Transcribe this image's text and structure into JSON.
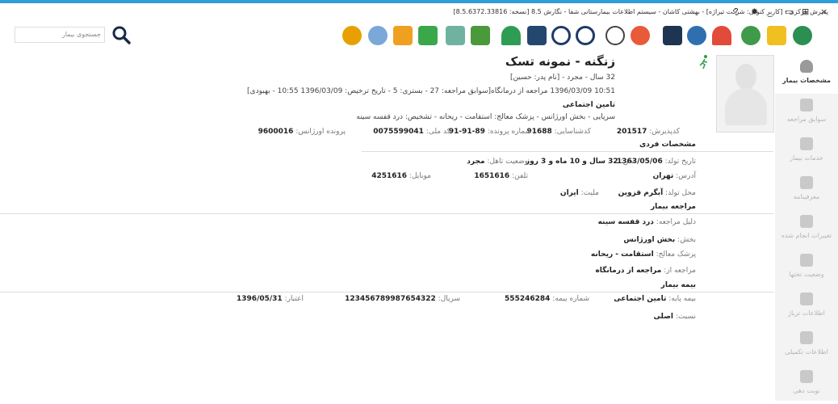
{
  "window": {
    "title": "پذیرش مرکزی - [کاربر کنونی: شرکت تیراژه] - بهشتی کاشان - سیستم اطلاعات بیمارستانی شفا - نگارش 8.5 [نسخه: 8.5.6372.33816]",
    "controls": [
      "?",
      "✹",
      "_",
      "▭",
      "⊞",
      "×"
    ]
  },
  "search": {
    "placeholder": "جستجوی بیمار"
  },
  "sidebar": {
    "items": [
      {
        "label": "مشخصات بیمار"
      },
      {
        "label": "سوابق مراجعه"
      },
      {
        "label": "خدمات بیمار"
      },
      {
        "label": "معرفینامه"
      },
      {
        "label": "تغییرات انجام شده"
      },
      {
        "label": "وضعیت تختها"
      },
      {
        "label": "اطلاعات تریاژ"
      },
      {
        "label": "اطلاعات تکمیلی"
      },
      {
        "label": "نوبت دهی"
      }
    ]
  },
  "patient": {
    "name": "زنگنه - نمونه تسک",
    "summary": "32 سال - مجرد - [نام پدر: حسین]",
    "visit_line": "10:51 1396/03/09 مراجعه از درمانگاه[سوابق مراجعه: 27 - بستری: 5 - تاریخ ترخیص: 1396/03/09 10:55 - بهبودی]",
    "insurance": "تامین اجتماعی",
    "ward_line": "سرپایی - بخش اورژانس - پزشک معالج: استقامت - ریحانه - تشخیص: درد قفسه سینه",
    "ids": {
      "reception_label": "کدپذیرش:",
      "reception": "201517",
      "codeshenasaei_label": "کدشناسایی:",
      "codeshenasaei": "91688",
      "file_label": "شماره پرونده:",
      "file": "89-91-91",
      "national_label": "کد ملی:",
      "national": "0075599041",
      "er_file_label": "پرونده اورژانس:",
      "er_file": "9600016"
    }
  },
  "personal": {
    "title": "مشخصات فردی",
    "birth_label": "تاریخ تولد:",
    "birth": "1363/05/06",
    "age_label": "سن:",
    "age": "32 سال و 10 ماه و 3 روز",
    "marital_label": "وضعیت تاهل:",
    "marital": "مجرد",
    "address_label": "آدرس:",
    "address": "تهران",
    "phone_label": "تلفن:",
    "phone": "1651616",
    "mobile_label": "موبایل:",
    "mobile": "4251616",
    "birthplace_label": "محل تولد:",
    "birthplace": "آبگرم قزوین",
    "nationality_label": "ملیت:",
    "nationality": "ایران"
  },
  "visit": {
    "title": "مراجعه بیمار",
    "reason_label": "دلیل مراجعه:",
    "reason": "درد قفسه سینه",
    "ward_label": "بخش:",
    "ward": "بخش اورژانس",
    "doctor_label": "پزشک معالج:",
    "doctor": "استقامت - ریحانه",
    "from_label": "مراجعه از:",
    "from": "مراجعه از درمانگاه"
  },
  "insurance": {
    "title": "بیمه بیمار",
    "base_label": "بیمه پایه:",
    "base": "تامین اجتماعی",
    "number_label": "شماره بیمه:",
    "number": "555246284",
    "serial_label": "سریال:",
    "serial": "123456789987654322",
    "validity_label": "اعتبار:",
    "validity": "1396/05/31",
    "relation_label": "نسبت:",
    "relation": "اصلی"
  },
  "toolbar_icons": [
    "gear-icon",
    "fingerprint-icon",
    "shuffle-icon",
    "basket-icon",
    "chart-report-icon",
    "bar-chart-icon",
    "umbrella-icon",
    "printer-icon",
    "back-icon",
    "forward-icon",
    "baby-icon",
    "clock-icon",
    "camera-icon",
    "link-icon",
    "ambulance-icon",
    "users-icon",
    "pencil-icon",
    "add-user-icon"
  ],
  "colors": {
    "accent": "#2f9ed8",
    "sidebar_bg": "#f3f3f3"
  }
}
